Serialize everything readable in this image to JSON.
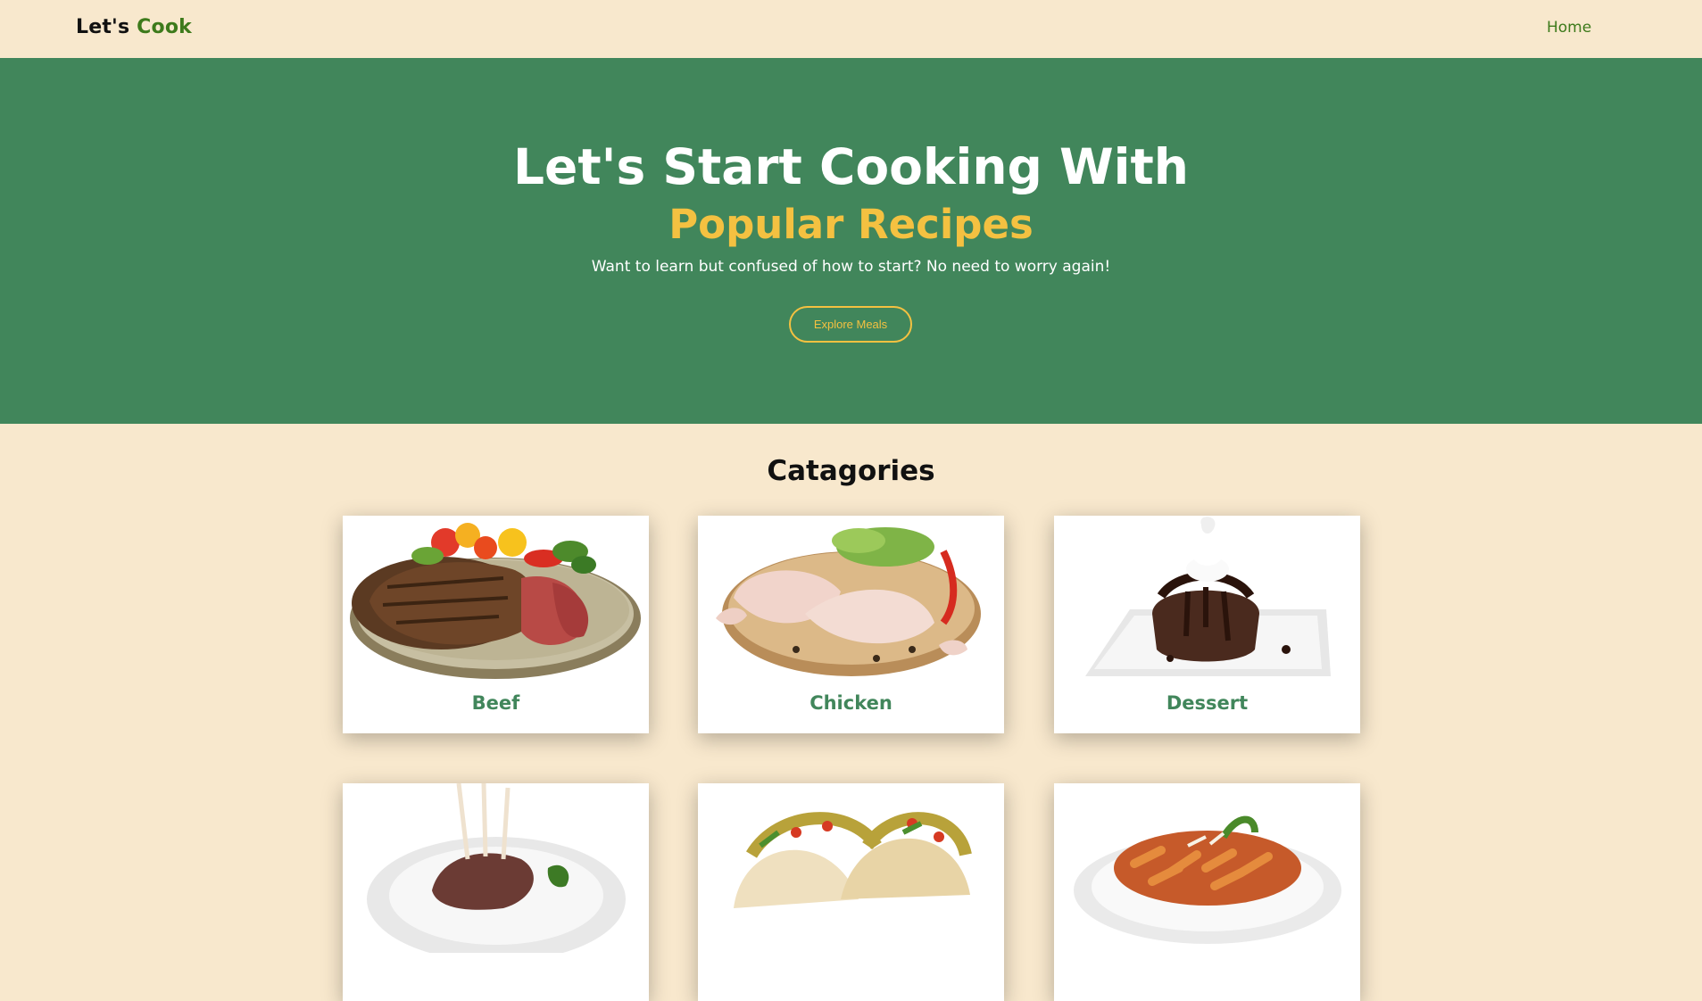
{
  "navbar": {
    "brand_prefix": "Let's",
    "brand_accent": "Cook",
    "home_link": "Home"
  },
  "hero": {
    "title": "Let's Start Cooking With",
    "highlight": "Popular Recipes",
    "subtitle": "Want to learn but confused of how to start? No need to worry again!",
    "cta_label": "Explore Meals"
  },
  "categories": {
    "heading": "Catagories",
    "items": [
      {
        "label": "Beef"
      },
      {
        "label": "Chicken"
      },
      {
        "label": "Dessert"
      },
      {
        "label": ""
      },
      {
        "label": ""
      },
      {
        "label": ""
      }
    ]
  },
  "colors": {
    "background": "#f8e8cd",
    "hero_green": "#41865b",
    "accent_yellow": "#f4c141",
    "brand_green": "#3d7a1b"
  }
}
